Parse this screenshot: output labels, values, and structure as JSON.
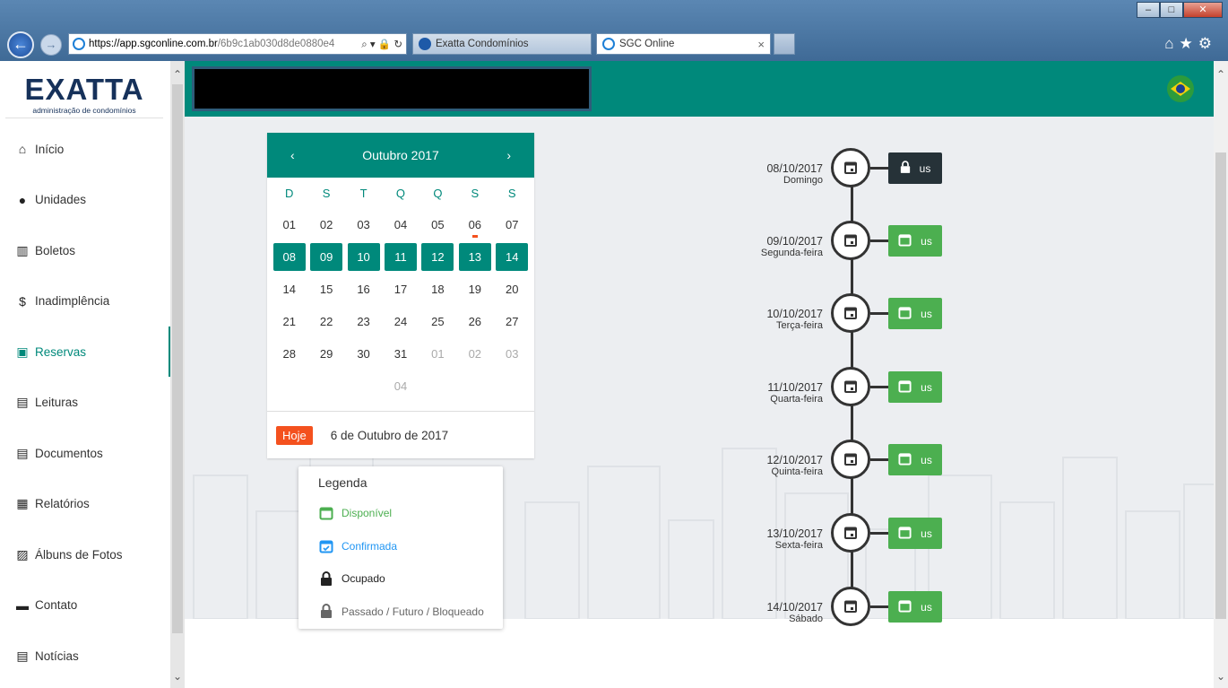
{
  "browser": {
    "url_host": "https://app.sgconline.com.br",
    "url_path": "/6b9c1ab030d8de0880e4",
    "url_controls": "⌕ ▾ 🔒 ↻",
    "tabs": [
      {
        "label": "Exatta Condomínios"
      },
      {
        "label": "SGC Online",
        "close": "×"
      }
    ]
  },
  "logo": {
    "word": "EXATTA",
    "tagline": "administração de condomínios"
  },
  "menu": [
    {
      "label": "Início",
      "icon": "home-icon",
      "glyph": "⌂"
    },
    {
      "label": "Unidades",
      "icon": "person-icon",
      "glyph": "●"
    },
    {
      "label": "Boletos",
      "icon": "barcode-icon",
      "glyph": "▥"
    },
    {
      "label": "Inadimplência",
      "icon": "dollar-icon",
      "glyph": "$"
    },
    {
      "label": "Reservas",
      "icon": "calendar-icon",
      "glyph": "▣"
    },
    {
      "label": "Leituras",
      "icon": "clipboard-icon",
      "glyph": "▤"
    },
    {
      "label": "Documentos",
      "icon": "document-icon",
      "glyph": "▤"
    },
    {
      "label": "Relatórios",
      "icon": "report-icon",
      "glyph": "▦"
    },
    {
      "label": "Álbuns de Fotos",
      "icon": "photo-icon",
      "glyph": "▨"
    },
    {
      "label": "Contato",
      "icon": "message-icon",
      "glyph": "▬"
    },
    {
      "label": "Notícias",
      "icon": "news-icon",
      "glyph": "▤"
    }
  ],
  "calendar": {
    "prev": "‹",
    "next": "›",
    "month_label": "Outubro 2017",
    "weekdays": [
      "D",
      "S",
      "T",
      "Q",
      "Q",
      "S",
      "S"
    ],
    "weeks": [
      [
        "01",
        "02",
        "03",
        "04",
        "05",
        "06",
        "07"
      ],
      [
        "08",
        "09",
        "10",
        "11",
        "12",
        "13",
        "14"
      ],
      [
        "14",
        "15",
        "16",
        "17",
        "18",
        "19",
        "20"
      ],
      [
        "21",
        "22",
        "23",
        "24",
        "25",
        "26",
        "27"
      ],
      [
        "28",
        "29",
        "30",
        "31",
        "01",
        "02",
        "03"
      ],
      [
        "",
        "",
        "",
        "04",
        "",
        "",
        ""
      ]
    ],
    "today_button": "Hoje",
    "today_text": "6 de Outubro de 2017"
  },
  "legend": {
    "title": "Legenda",
    "items": [
      {
        "label": "Disponível",
        "color": "#4caf50",
        "icon": "calendar-available-icon"
      },
      {
        "label": "Confirmada",
        "color": "#2196f3",
        "icon": "calendar-check-icon"
      },
      {
        "label": "Ocupado",
        "color": "#222222",
        "icon": "lock-icon"
      },
      {
        "label": "Passado / Futuro / Bloqueado",
        "color": "#666666",
        "icon": "lock-gray-icon"
      }
    ]
  },
  "timeline": [
    {
      "date": "08/10/2017",
      "weekday": "Domingo",
      "status": "busy",
      "label": "us"
    },
    {
      "date": "09/10/2017",
      "weekday": "Segunda-feira",
      "status": "free",
      "label": "us"
    },
    {
      "date": "10/10/2017",
      "weekday": "Terça-feira",
      "status": "free",
      "label": "us"
    },
    {
      "date": "11/10/2017",
      "weekday": "Quarta-feira",
      "status": "free",
      "label": "us"
    },
    {
      "date": "12/10/2017",
      "weekday": "Quinta-feira",
      "status": "free",
      "label": "us"
    },
    {
      "date": "13/10/2017",
      "weekday": "Sexta-feira",
      "status": "free",
      "label": "us"
    },
    {
      "date": "14/10/2017",
      "weekday": "Sábado",
      "status": "free",
      "label": "us"
    }
  ],
  "colors": {
    "primary": "#00897b",
    "available": "#4caf50",
    "occupied": "#263238",
    "today": "#f4511e",
    "confirmed": "#2196f3"
  }
}
